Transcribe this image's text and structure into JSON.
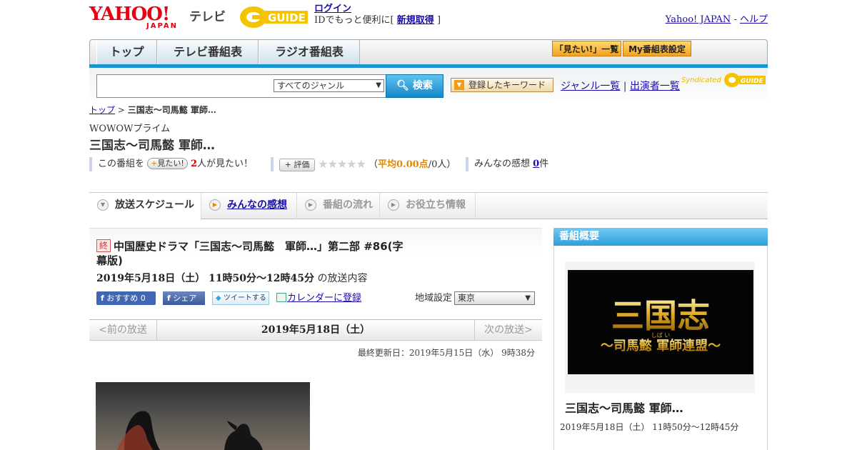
{
  "header": {
    "yahoo_logo": "YAHOO!",
    "yahoo_sub": "JAPAN",
    "tv_label": "テレビ",
    "gguide_logo": "G-GUIDE",
    "login_link": "ログイン",
    "login_note_pre": "IDでもっと便利に[",
    "register_link": "新規取得",
    "login_note_post": "]",
    "yahoo_japan_link": "Yahoo! JAPAN",
    "separator": "-",
    "help_link": "ヘルプ"
  },
  "nav": {
    "tabs": [
      "トップ",
      "テレビ番組表",
      "ラジオ番組表"
    ],
    "mitai_list": "「見たい!」一覧",
    "my_schedule": "My番組表設定"
  },
  "search": {
    "genre_selected": "すべてのジャンル",
    "search_button": "検索",
    "keyword_button": "登録したキーワード",
    "genre_list_link": "ジャンル一覧",
    "divider": "|",
    "cast_list_link": "出演者一覧",
    "syndicated": "Syndicated"
  },
  "breadcrumb": {
    "top": "トップ",
    "sep": ">",
    "current": "三国志～司馬懿 軍師…"
  },
  "program": {
    "channel": "WOWOWプライム",
    "title": "三国志～司馬懿 軍師…",
    "stats": {
      "prefix": "この番組を",
      "mitai_button": "見たい!",
      "mitai_count": "2",
      "mitai_suffix": "人が見たい！",
      "eval_button": "評価",
      "stars": "★★★★★",
      "avg_open": "（",
      "avg_label": "平均0.00点",
      "avg_people": "/0人）",
      "impressions_label": "みんなの感想",
      "impressions_count": "0",
      "impressions_unit": "件"
    },
    "subtabs": [
      "放送スケジュール",
      "みんなの感想",
      "番組の流れ",
      "お役立ち情報"
    ],
    "end_badge": "終",
    "full_title": "中国歴史ドラマ「三国志～司馬懿　軍師…」第二部 #86(字幕版)",
    "broadcast_time": "2019年5月18日（土）  11時50分～12時45分",
    "broadcast_suffix": "の放送内容",
    "share": {
      "fb_recommend": "おすすめ",
      "fb_count": "0",
      "fb_share": "シェア",
      "tweet": "ツイートする",
      "calendar": "カレンダーに登録"
    },
    "area_label": "地域設定",
    "area_selected": "東京",
    "date_nav": {
      "prev": "<前の放送",
      "current": "2019年5月18日（土）",
      "next": "次の放送>"
    },
    "updated": "最終更新日：2019年5月15日（水）  9時38分"
  },
  "sidebar": {
    "heading": "番組概要",
    "image_title": "三国志",
    "image_ruby": "しば い",
    "image_subtitle": "～司馬懿 軍師連盟～",
    "title": "三国志～司馬懿 軍師…",
    "time": "2019年5月18日（土）  11時50分～12時45分"
  },
  "colors": {
    "accent_blue": "#1c93d4",
    "yahoo_red": "#e60012",
    "gguide_yellow": "#f5c400",
    "orange_button": "#f3a21e"
  }
}
